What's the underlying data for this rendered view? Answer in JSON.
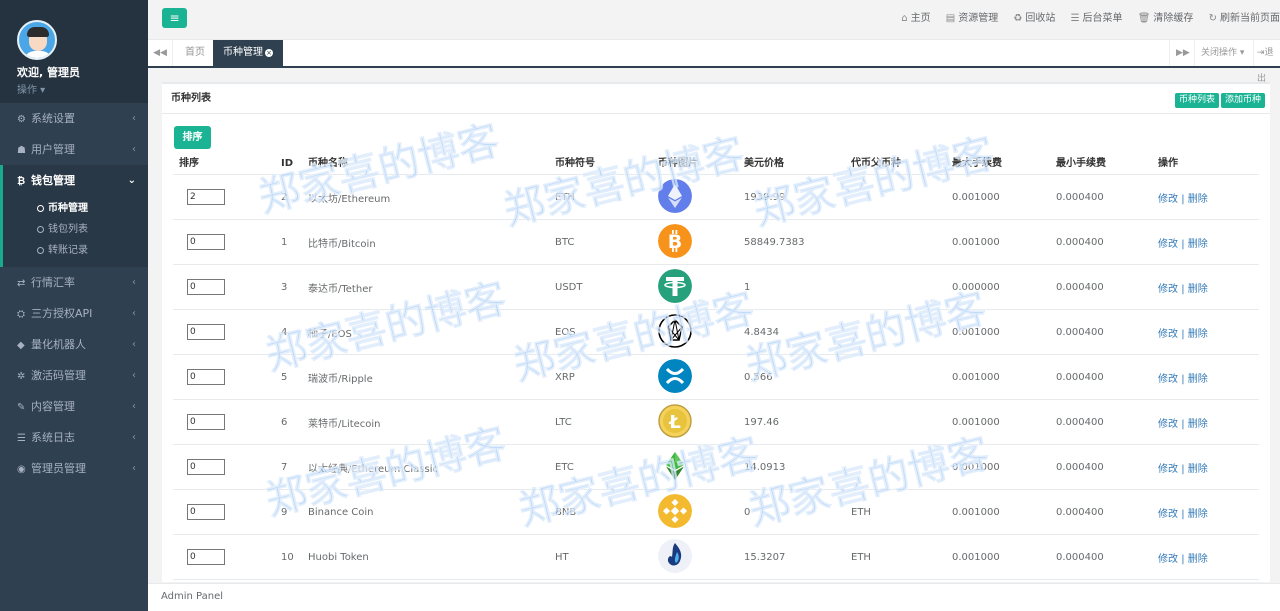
{
  "sidebar": {
    "welcome": "欢迎, 管理员",
    "operation": "操作 ▾",
    "items": [
      {
        "label": "系统设置",
        "icon": "gears-icon"
      },
      {
        "label": "用户管理",
        "icon": "users-icon"
      },
      {
        "label": "钱包管理",
        "icon": "bitcoin-icon"
      },
      {
        "label": "行情汇率",
        "icon": "exchange-icon"
      },
      {
        "label": "三方授权API",
        "icon": "api-icon"
      },
      {
        "label": "量化机器人",
        "icon": "robot-icon"
      },
      {
        "label": "激活码管理",
        "icon": "key-icon"
      },
      {
        "label": "内容管理",
        "icon": "edit-icon"
      },
      {
        "label": "系统日志",
        "icon": "database-icon"
      },
      {
        "label": "管理员管理",
        "icon": "user-circle-icon"
      }
    ],
    "wallet_sub": [
      "币种管理",
      "钱包列表",
      "转账记录"
    ]
  },
  "topbar": {
    "links": [
      "主页",
      "资源管理",
      "回收站",
      "后台菜单",
      "清除缓存",
      "刷新当前页面"
    ]
  },
  "tabs": {
    "home": "首页",
    "current": "币种管理",
    "close_ops": "关闭操作 ▾",
    "logout": "退出"
  },
  "panel": {
    "title": "币种列表",
    "btn_list": "币种列表",
    "btn_add": "添加币种",
    "btn_sort": "排序"
  },
  "table": {
    "headers": [
      "排序",
      "ID",
      "币种名称",
      "币种符号",
      "币种图片",
      "美元价格",
      "代币父币种",
      "最大手续费",
      "最小手续费",
      "操作"
    ],
    "edit_label": "修改",
    "sep": "|",
    "delete_label": "删除",
    "rows": [
      {
        "sort": "2",
        "id": "2",
        "name": "以太坊/Ethereum",
        "symbol": "ETH",
        "price": "1939.99",
        "parent": "",
        "max_fee": "0.001000",
        "min_fee": "0.000400",
        "logo": "eth"
      },
      {
        "sort": "0",
        "id": "1",
        "name": "比特币/Bitcoin",
        "symbol": "BTC",
        "price": "58849.7383",
        "parent": "",
        "max_fee": "0.001000",
        "min_fee": "0.000400",
        "logo": "btc"
      },
      {
        "sort": "0",
        "id": "3",
        "name": "泰达币/Tether",
        "symbol": "USDT",
        "price": "1",
        "parent": "",
        "max_fee": "0.000000",
        "min_fee": "0.000400",
        "logo": "usdt"
      },
      {
        "sort": "0",
        "id": "4",
        "name": "柚子/EOS",
        "symbol": "EOS",
        "price": "4.8434",
        "parent": "",
        "max_fee": "0.001000",
        "min_fee": "0.000400",
        "logo": "eos"
      },
      {
        "sort": "0",
        "id": "5",
        "name": "瑞波币/Ripple",
        "symbol": "XRP",
        "price": "0.566",
        "parent": "",
        "max_fee": "0.001000",
        "min_fee": "0.000400",
        "logo": "xrp"
      },
      {
        "sort": "0",
        "id": "6",
        "name": "莱特币/Litecoin",
        "symbol": "LTC",
        "price": "197.46",
        "parent": "",
        "max_fee": "0.001000",
        "min_fee": "0.000400",
        "logo": "ltc"
      },
      {
        "sort": "0",
        "id": "7",
        "name": "以太经典/Ethereum Classic",
        "symbol": "ETC",
        "price": "14.0913",
        "parent": "",
        "max_fee": "0.001000",
        "min_fee": "0.000400",
        "logo": "etc"
      },
      {
        "sort": "0",
        "id": "9",
        "name": "Binance Coin",
        "symbol": "BNB",
        "price": "0",
        "parent": "ETH",
        "max_fee": "0.001000",
        "min_fee": "0.000400",
        "logo": "bnb"
      },
      {
        "sort": "0",
        "id": "10",
        "name": "Huobi Token",
        "symbol": "HT",
        "price": "15.3207",
        "parent": "ETH",
        "max_fee": "0.001000",
        "min_fee": "0.000400",
        "logo": "ht"
      }
    ]
  },
  "footer": "Admin Panel",
  "watermark": "郑家喜的博客",
  "colors": {
    "accent": "#1ab394",
    "sidebar": "#2f4050",
    "link": "#337ab7"
  }
}
